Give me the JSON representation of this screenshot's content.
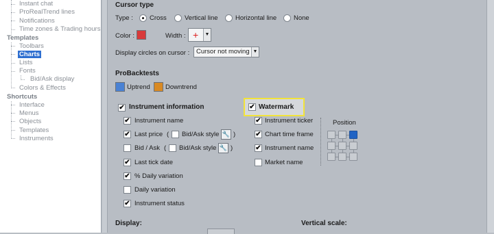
{
  "tree": {
    "items": [
      {
        "label": "Instant chat",
        "type": "leaf"
      },
      {
        "label": "ProRealTrend lines",
        "type": "leaf"
      },
      {
        "label": "Notifications",
        "type": "leaf"
      },
      {
        "label": "Time zones & Trading hours",
        "type": "leaf"
      },
      {
        "label": "Templates",
        "type": "category"
      },
      {
        "label": "Toolbars",
        "type": "leaf"
      },
      {
        "label": "Charts",
        "type": "selected"
      },
      {
        "label": "Lists",
        "type": "leaf"
      },
      {
        "label": "Fonts",
        "type": "leaf"
      },
      {
        "label": "Bid/Ask display",
        "type": "leaf"
      },
      {
        "label": "Colors & Effects",
        "type": "leaf"
      },
      {
        "label": "Shortcuts",
        "type": "category"
      },
      {
        "label": "Interface",
        "type": "leaf"
      },
      {
        "label": "Menus",
        "type": "leaf"
      },
      {
        "label": "Objects",
        "type": "leaf"
      },
      {
        "label": "Templates",
        "type": "leaf"
      },
      {
        "label": "Instruments",
        "type": "leaf"
      }
    ]
  },
  "cursor": {
    "title": "Cursor type",
    "type_label": "Type :",
    "type_options": [
      "Cross",
      "Vertical line",
      "Horizontal line",
      "None"
    ],
    "type_selected": "Cross",
    "color_label": "Color :",
    "color_value": "#d83a3a",
    "width_label": "Width :",
    "width_symbol": "+",
    "circles_label": "Display circles on cursor :",
    "circles_value": "Cursor not moving"
  },
  "probacktests": {
    "title": "ProBacktests",
    "uptrend_label": "Uptrend",
    "uptrend_color": "#4a82d4",
    "downtrend_label": "Downtrend",
    "downtrend_color": "#d98a24"
  },
  "instrument_info": {
    "title": "Instrument information",
    "checked": true,
    "options": [
      {
        "label": "Instrument name",
        "checked": true
      },
      {
        "label": "Last price",
        "checked": true,
        "paren_open": "(",
        "bidask_label": "Bid/Ask style",
        "paren_close": ")"
      },
      {
        "label": "Bid / Ask",
        "checked": false,
        "paren_open": "(",
        "bidask_label": "Bid/Ask style",
        "paren_close": ")"
      },
      {
        "label": "Last tick date",
        "checked": true
      },
      {
        "label": "% Daily variation",
        "checked": true
      },
      {
        "label": "Daily variation",
        "checked": false
      },
      {
        "label": "Instrument status",
        "checked": true
      }
    ]
  },
  "watermark": {
    "title": "Watermark",
    "checked": true,
    "options": [
      {
        "label": "Instrument ticker",
        "checked": true
      },
      {
        "label": "Chart time frame",
        "checked": true
      },
      {
        "label": "Instrument name",
        "checked": true
      },
      {
        "label": "Market name",
        "checked": false
      }
    ],
    "position_label": "Position",
    "position_selected": "top-right"
  },
  "bottom": {
    "display_label": "Display:",
    "vertical_scale_label": "Vertical scale:"
  },
  "icons": {
    "check": "✔",
    "wrench": "🔧",
    "dropdown_arrow": "▼"
  }
}
